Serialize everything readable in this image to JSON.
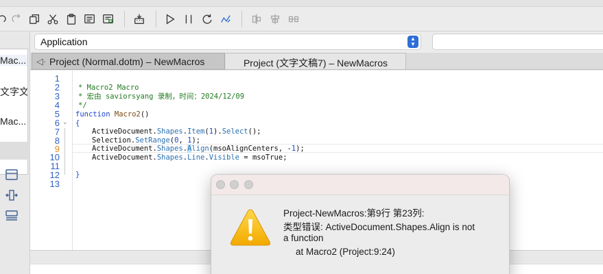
{
  "toolbar": {
    "icons": [
      "redo-icon",
      "copy-icon",
      "cut-icon",
      "paste-icon",
      "insert-userform-icon",
      "insert-module-icon",
      "macro-build-icon",
      "run-icon",
      "pause-icon",
      "reset-icon",
      "design-mode-icon",
      "align-left-icon",
      "align-center-icon",
      "align-distribute-icon"
    ]
  },
  "combo": {
    "value": "Application"
  },
  "project_list": {
    "items": [
      {
        "label": "Mac..."
      },
      {
        "label": "文字文..."
      },
      {
        "label": "Mac..."
      }
    ]
  },
  "tabs": [
    {
      "label": "Project (Normal.dotm) – NewMacros",
      "active": true
    },
    {
      "label": "Project (文字文稿7) – NewMacros",
      "active": false
    }
  ],
  "editor": {
    "line_numbers": [
      "1",
      "2",
      "3",
      "4",
      "5",
      "6",
      "7",
      "8",
      "9",
      "10",
      "11",
      "12",
      "13"
    ],
    "current_line": 9,
    "lines": {
      "l2": "* Macro2 Macro",
      "l3": "* 宏由 saviorsyang 录制，时间：2024/12/09",
      "l4": "*/",
      "l5_kw": "function",
      "l5_name": "Macro2",
      "l5_rest": "()",
      "l6": "{",
      "l7_a": "ActiveDocument.",
      "l7_b": "Shapes",
      "l7_c": ".",
      "l7_d": "Item",
      "l7_e": "(",
      "l7_f": "1",
      "l7_g": ").",
      "l7_h": "Select",
      "l7_i": "();",
      "l8_a": "Selection.",
      "l8_b": "SetRange",
      "l8_c": "(",
      "l8_d": "0",
      "l8_e": ", ",
      "l8_f": "1",
      "l8_g": ");",
      "l9_a": "ActiveDocument.",
      "l9_b": "Shapes",
      "l9_c": ".",
      "l9_d": "A",
      "l9_e": "lign",
      "l9_f": "(msoAlignCenters, -",
      "l9_g": "1",
      "l9_h": ");",
      "l10_a": "ActiveDocument.",
      "l10_b": "Shapes",
      "l10_c": ".",
      "l10_d": "Line",
      "l10_e": ".",
      "l10_f": "Visible",
      "l10_g": " = msoTrue;",
      "l12": "}"
    }
  },
  "dialog": {
    "line1": "Project-NewMacros:第9行 第23列:",
    "line2": "类型错误: ActiveDocument.Shapes.Align is not",
    "line3": "a function",
    "line4": "at Macro2 (Project:9:24)"
  },
  "colors": {
    "accent": "#2e6fd6",
    "comment": "#1f7a1f",
    "keyword": "#1d43c9",
    "line_number": "#2f5fc7",
    "current_line_number": "#e28a1b",
    "warning": "#f5b800"
  }
}
